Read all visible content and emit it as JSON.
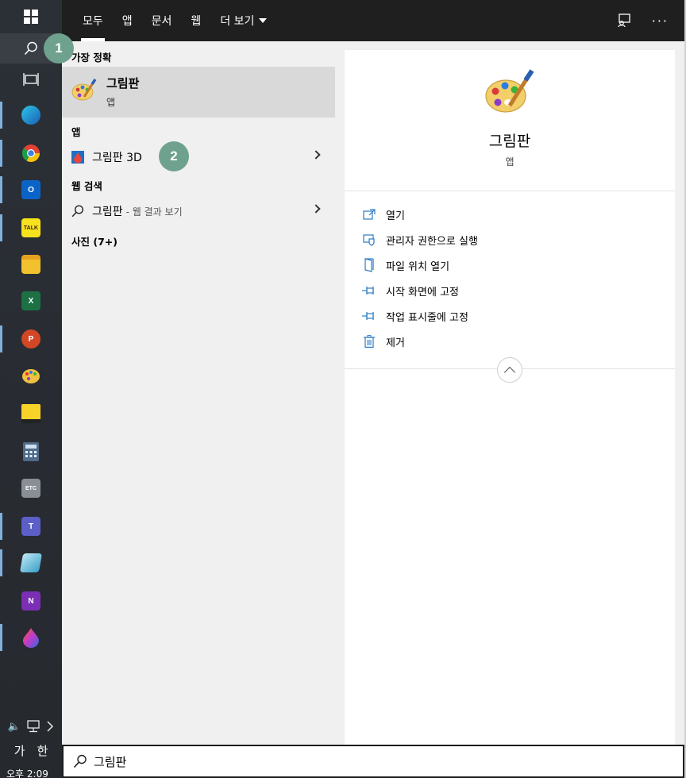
{
  "taskbar": {
    "clock": "오후 2:09",
    "ime_left": "가",
    "ime_right": "한",
    "apps": [
      {
        "icon": "copilot-swirl-icon",
        "color": "#1a8fd1"
      },
      {
        "icon": "chrome-icon",
        "color": "#e34133"
      },
      {
        "icon": "outlook-icon",
        "color": "#0a64c8"
      },
      {
        "icon": "kakaotalk-icon",
        "color": "#f7e21d"
      },
      {
        "icon": "file-explorer-icon",
        "color": "#f2c12e"
      },
      {
        "icon": "excel-icon",
        "color": "#1d7044"
      },
      {
        "icon": "powerpoint-icon",
        "color": "#d24726"
      },
      {
        "icon": "paint-icon",
        "color": "#f0c040"
      },
      {
        "icon": "sticky-notes-icon",
        "color": "#f7d32a"
      },
      {
        "icon": "calculator-icon",
        "color": "#4e6b8a"
      },
      {
        "icon": "etc-app-icon",
        "color": "#8a8f96"
      },
      {
        "icon": "teams-icon",
        "color": "#5b5fc7"
      },
      {
        "icon": "snipping-tool-icon",
        "color": "#3aa0c8"
      },
      {
        "icon": "onenote-icon",
        "color": "#7b2fb5"
      },
      {
        "icon": "paint-3d-icon",
        "color": "#e8453c"
      }
    ],
    "kakao_label": "TALK",
    "etc_label": "ETC"
  },
  "tabs": [
    {
      "label": "모두",
      "active": true
    },
    {
      "label": "앱",
      "active": false
    },
    {
      "label": "문서",
      "active": false
    },
    {
      "label": "웹",
      "active": false
    },
    {
      "label": "더 보기",
      "active": false
    }
  ],
  "results": {
    "best_match_header": "가장 정확",
    "best_match": {
      "title": "그림판",
      "subtitle": "앱"
    },
    "apps_header": "앱",
    "app_item": "그림판 3D",
    "web_header": "웹 검색",
    "web_item": "그림판",
    "web_item_sub": "- 웹 결과 보기",
    "photos_header": "사진 (7+)"
  },
  "detail": {
    "title": "그림판",
    "subtitle": "앱",
    "actions": [
      {
        "label": "열기",
        "icon": "open-icon"
      },
      {
        "label": "관리자 권한으로 실행",
        "icon": "shield-icon"
      },
      {
        "label": "파일 위치 열기",
        "icon": "file-location-icon"
      },
      {
        "label": "시작 화면에 고정",
        "icon": "pin-icon"
      },
      {
        "label": "작업 표시줄에 고정",
        "icon": "pin-icon"
      },
      {
        "label": "제거",
        "icon": "trash-icon"
      }
    ]
  },
  "search": {
    "value": "그림판"
  },
  "markers": {
    "one": "1",
    "two": "2"
  },
  "colors": {
    "accent": "#2b7bc4",
    "marker": "#6fa28e",
    "topbar": "#1f1f1f"
  }
}
